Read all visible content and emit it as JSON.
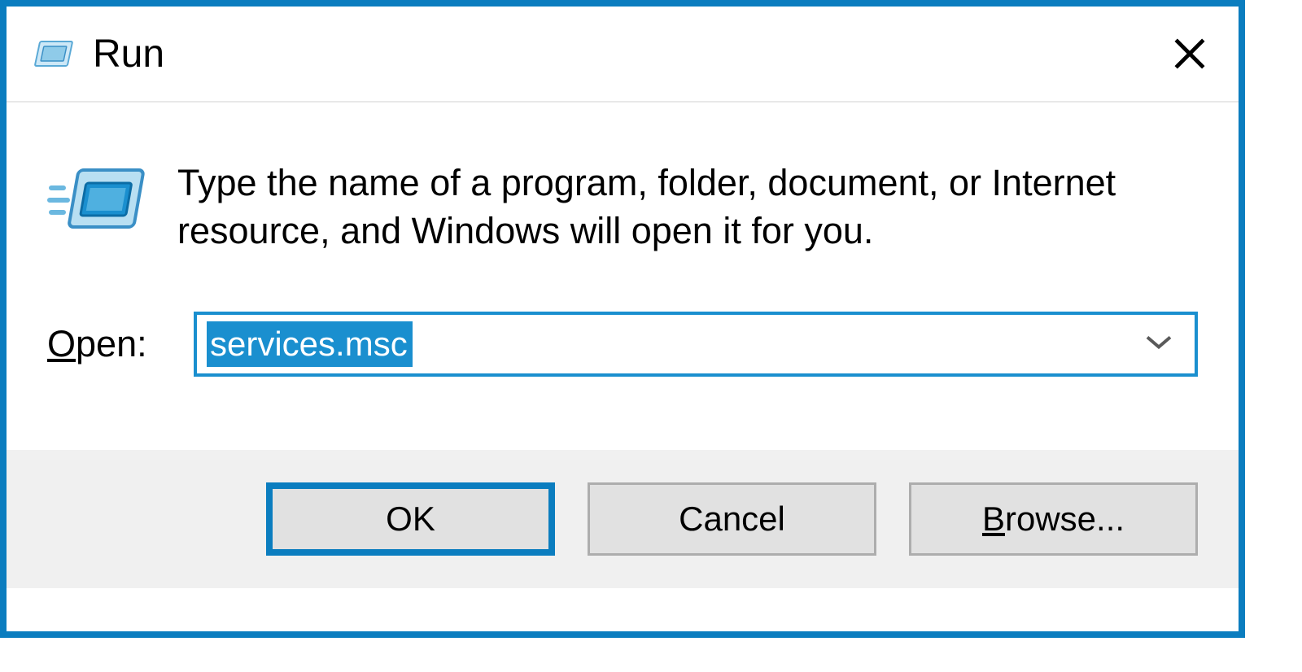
{
  "titlebar": {
    "title": "Run"
  },
  "content": {
    "description": "Type the name of a program, folder, document, or Internet resource, and Windows will open it for you.",
    "open_label_prefix": "O",
    "open_label_rest": "pen:",
    "input_value": "services.msc"
  },
  "buttons": {
    "ok": "OK",
    "cancel": "Cancel",
    "browse_prefix": "B",
    "browse_rest": "rowse..."
  }
}
